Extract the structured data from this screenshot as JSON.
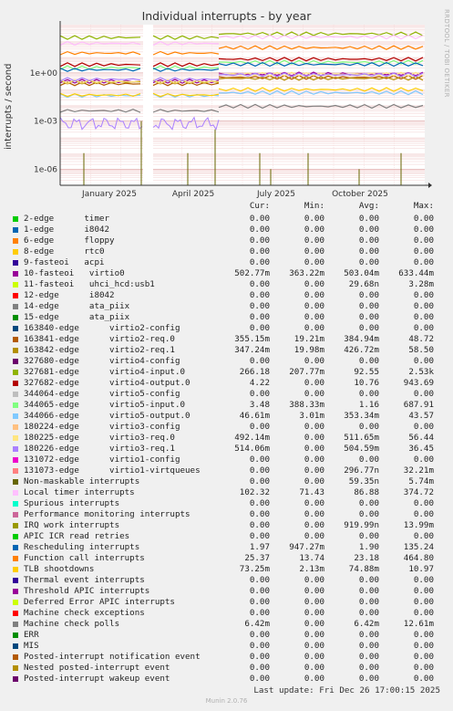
{
  "title": "Individual interrupts - by year",
  "side_text": "RRDTOOL / TOBI OETIKER",
  "footer": {
    "last_update": "Last update: Fri Dec 26 17:00:15 2025",
    "munin": "Munin 2.0.76"
  },
  "columns": {
    "cur": "Cur:",
    "min": "Min:",
    "avg": "Avg:",
    "max": "Max:"
  },
  "chart_data": {
    "type": "line",
    "title": "Individual interrupts - by year",
    "ylabel": "interrupts / second",
    "y_scale": "log",
    "ylim": [
      1e-07,
      1000
    ],
    "y_ticks": [
      {
        "value": 1,
        "label": "1e+00"
      },
      {
        "value": 0.001,
        "label": "1e-03"
      },
      {
        "value": 1e-06,
        "label": "1e-06"
      }
    ],
    "x_ticks": [
      "January 2025",
      "April 2025",
      "July 2025",
      "October 2025"
    ],
    "grid": true,
    "legend_position": "below",
    "gap": "between January and April 2025",
    "series": [
      {
        "name": "2-edge      timer",
        "color": "#00cc00",
        "cur": "0.00",
        "min": "0.00",
        "avg": "0.00",
        "max": "0.00"
      },
      {
        "name": "1-edge      i8042",
        "color": "#0066b3",
        "cur": "0.00",
        "min": "0.00",
        "avg": "0.00",
        "max": "0.00"
      },
      {
        "name": "6-edge      floppy",
        "color": "#ff8000",
        "cur": "0.00",
        "min": "0.00",
        "avg": "0.00",
        "max": "0.00"
      },
      {
        "name": "8-edge      rtc0",
        "color": "#ffcc00",
        "cur": "0.00",
        "min": "0.00",
        "avg": "0.00",
        "max": "0.00"
      },
      {
        "name": "9-fasteoi   acpi",
        "color": "#330099",
        "cur": "0.00",
        "min": "0.00",
        "avg": "0.00",
        "max": "0.00"
      },
      {
        "name": "10-fasteoi   virtio0",
        "color": "#990099",
        "cur": "502.77m",
        "min": "363.22m",
        "avg": "503.04m",
        "max": "633.44m",
        "level": 0.5
      },
      {
        "name": "11-fasteoi   uhci_hcd:usb1",
        "color": "#ccff00",
        "cur": "0.00",
        "min": "0.00",
        "avg": "29.68n",
        "max": "3.28m"
      },
      {
        "name": "12-edge      i8042",
        "color": "#ff0000",
        "cur": "0.00",
        "min": "0.00",
        "avg": "0.00",
        "max": "0.00"
      },
      {
        "name": "14-edge      ata_piix",
        "color": "#808080",
        "cur": "0.00",
        "min": "0.00",
        "avg": "0.00",
        "max": "0.00"
      },
      {
        "name": "15-edge      ata_piix",
        "color": "#008f00",
        "cur": "0.00",
        "min": "0.00",
        "avg": "0.00",
        "max": "0.00"
      },
      {
        "name": "163840-edge      virtio2-config",
        "color": "#00487d",
        "cur": "0.00",
        "min": "0.00",
        "avg": "0.00",
        "max": "0.00"
      },
      {
        "name": "163841-edge      virtio2-req.0",
        "color": "#b35a00",
        "cur": "355.15m",
        "min": "19.21m",
        "avg": "384.94m",
        "max": "48.72",
        "level": 0.35
      },
      {
        "name": "163842-edge      virtio2-req.1",
        "color": "#b38f00",
        "cur": "347.24m",
        "min": "19.98m",
        "avg": "426.72m",
        "max": "58.50",
        "level": 0.35
      },
      {
        "name": "327680-edge      virtio4-config",
        "color": "#6b006b",
        "cur": "0.00",
        "min": "0.00",
        "avg": "0.00",
        "max": "0.00"
      },
      {
        "name": "327681-edge      virtio4-input.0",
        "color": "#8fb300",
        "cur": "266.18",
        "min": "207.77m",
        "avg": "92.55",
        "max": "2.53k",
        "level": 266
      },
      {
        "name": "327682-edge      virtio4-output.0",
        "color": "#b30000",
        "cur": "4.22",
        "min": "0.00",
        "avg": "10.76",
        "max": "943.69",
        "level": 4.2
      },
      {
        "name": "344064-edge      virtio5-config",
        "color": "#bebebe",
        "cur": "0.00",
        "min": "0.00",
        "avg": "0.00",
        "max": "0.00"
      },
      {
        "name": "344065-edge      virtio5-input.0",
        "color": "#80ff80",
        "cur": "3.48",
        "min": "388.33m",
        "avg": "1.16",
        "max": "687.91",
        "level": 3.5
      },
      {
        "name": "344066-edge      virtio5-output.0",
        "color": "#80c9ff",
        "cur": "46.61m",
        "min": "3.01m",
        "avg": "353.34m",
        "max": "43.57",
        "level": 0.05
      },
      {
        "name": "180224-edge      virtio3-config",
        "color": "#ffc080",
        "cur": "0.00",
        "min": "0.00",
        "avg": "0.00",
        "max": "0.00"
      },
      {
        "name": "180225-edge      virtio3-req.0",
        "color": "#ffe680",
        "cur": "492.14m",
        "min": "0.00",
        "avg": "511.65m",
        "max": "56.44",
        "level": 0.49
      },
      {
        "name": "180226-edge      virtio3-req.1",
        "color": "#aa80ff",
        "cur": "514.06m",
        "min": "0.00",
        "avg": "504.59m",
        "max": "36.45",
        "level": 0.51
      },
      {
        "name": "131072-edge      virtio1-config",
        "color": "#ee00cc",
        "cur": "0.00",
        "min": "0.00",
        "avg": "0.00",
        "max": "0.00"
      },
      {
        "name": "131073-edge      virtio1-virtqueues",
        "color": "#ff8080",
        "cur": "0.00",
        "min": "0.00",
        "avg": "296.77n",
        "max": "32.21m"
      },
      {
        "name": "Non-maskable interrupts",
        "color": "#666600",
        "cur": "0.00",
        "min": "0.00",
        "avg": "59.35n",
        "max": "5.74m"
      },
      {
        "name": "Local timer interrupts",
        "color": "#ffbfff",
        "cur": "102.32",
        "min": "71.43",
        "avg": "86.88",
        "max": "374.72",
        "level": 100
      },
      {
        "name": "Spurious interrupts",
        "color": "#00ffcc",
        "cur": "0.00",
        "min": "0.00",
        "avg": "0.00",
        "max": "0.00"
      },
      {
        "name": "Performance monitoring interrupts",
        "color": "#cc6699",
        "cur": "0.00",
        "min": "0.00",
        "avg": "0.00",
        "max": "0.00"
      },
      {
        "name": "IRQ work interrupts",
        "color": "#999900",
        "cur": "0.00",
        "min": "0.00",
        "avg": "919.99n",
        "max": "13.99m"
      },
      {
        "name": "APIC ICR read retries",
        "color": "#00cc00",
        "cur": "0.00",
        "min": "0.00",
        "avg": "0.00",
        "max": "0.00"
      },
      {
        "name": "Rescheduling interrupts",
        "color": "#0066b3",
        "cur": "1.97",
        "min": "947.27m",
        "avg": "1.90",
        "max": "135.24",
        "level": 2
      },
      {
        "name": "Function call interrupts",
        "color": "#ff8000",
        "cur": "25.37",
        "min": "13.74",
        "avg": "23.18",
        "max": "464.80",
        "level": 25
      },
      {
        "name": "TLB shootdowns",
        "color": "#ffcc00",
        "cur": "73.25m",
        "min": "2.13m",
        "avg": "74.88m",
        "max": "10.97",
        "level": 0.07
      },
      {
        "name": "Thermal event interrupts",
        "color": "#330099",
        "cur": "0.00",
        "min": "0.00",
        "avg": "0.00",
        "max": "0.00"
      },
      {
        "name": "Threshold APIC interrupts",
        "color": "#990099",
        "cur": "0.00",
        "min": "0.00",
        "avg": "0.00",
        "max": "0.00"
      },
      {
        "name": "Deferred Error APIC interrupts",
        "color": "#ccff00",
        "cur": "0.00",
        "min": "0.00",
        "avg": "0.00",
        "max": "0.00"
      },
      {
        "name": "Machine check exceptions",
        "color": "#ff0000",
        "cur": "0.00",
        "min": "0.00",
        "avg": "0.00",
        "max": "0.00"
      },
      {
        "name": "Machine check polls",
        "color": "#808080",
        "cur": "6.42m",
        "min": "0.00",
        "avg": "6.42m",
        "max": "12.61m",
        "level": 0.0064
      },
      {
        "name": "ERR",
        "color": "#008f00",
        "cur": "0.00",
        "min": "0.00",
        "avg": "0.00",
        "max": "0.00"
      },
      {
        "name": "MIS",
        "color": "#00487d",
        "cur": "0.00",
        "min": "0.00",
        "avg": "0.00",
        "max": "0.00"
      },
      {
        "name": "Posted-interrupt notification event",
        "color": "#b35a00",
        "cur": "0.00",
        "min": "0.00",
        "avg": "0.00",
        "max": "0.00"
      },
      {
        "name": "Nested posted-interrupt event",
        "color": "#b38f00",
        "cur": "0.00",
        "min": "0.00",
        "avg": "0.00",
        "max": "0.00"
      },
      {
        "name": "Posted-interrupt wakeup event",
        "color": "#6b006b",
        "cur": "0.00",
        "min": "0.00",
        "avg": "0.00",
        "max": "0.00"
      }
    ]
  }
}
